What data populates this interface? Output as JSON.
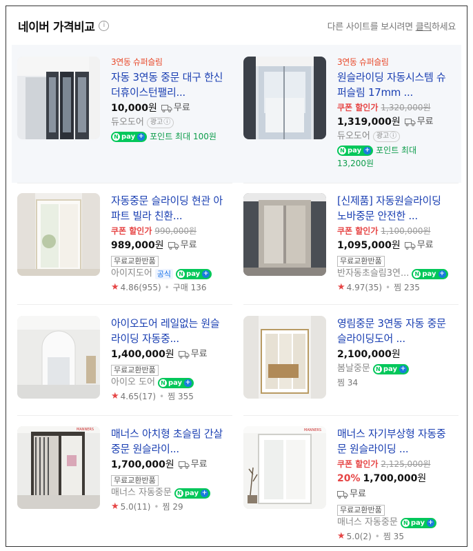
{
  "header": {
    "title": "네이버 가격비교",
    "info_icon": "i",
    "right_prefix": "다른 사이트를 보시려면 ",
    "right_link": "클릭",
    "right_suffix": "하세요"
  },
  "colors": {
    "link": "#1a3fb2",
    "coupon": "#e64545",
    "npay": "#03c75a",
    "accent_tag": "#e8492a"
  },
  "products": [
    {
      "tag": "3연동 슈퍼슬림",
      "title": "자동 3연동 중문 대구 한신더휴이스턴팰리...",
      "price": "10,000",
      "unit": "원",
      "shipping": "무료",
      "seller": "듀오도어",
      "ad_label": "광고",
      "npay": "pay",
      "point": "포인트 최대 100원"
    },
    {
      "tag": "3연동 슈퍼슬림",
      "title": "원슬라이딩 자동시스템 슈퍼슬림 17mm ...",
      "coupon": "쿠폰 할인가",
      "original_price": "1,320,000원",
      "price": "1,319,000",
      "unit": "원",
      "shipping": "무료",
      "seller": "듀오도어",
      "ad_label": "광고",
      "npay": "pay",
      "point": "포인트 최대",
      "point2": "13,200원"
    },
    {
      "title": "자동중문 슬라이딩 현관 아파트 빌라 친환...",
      "coupon": "쿠폰 할인가",
      "original_price": "990,000원",
      "price": "989,000",
      "unit": "원",
      "shipping": "무료",
      "badge": "무료교환반품",
      "seller": "아이지도어",
      "official": "공식",
      "npay": "pay",
      "rating": "4.86",
      "rating_count": "(955)",
      "stat": "구매 136"
    },
    {
      "title": "[신제품] 자동원슬라이딩 노바중문 안전한 ...",
      "coupon": "쿠폰 할인가",
      "original_price": "1,100,000원",
      "price": "1,095,000",
      "unit": "원",
      "shipping": "무료",
      "badge": "무료교환반품",
      "seller": "반자동초슬림3연...",
      "npay": "pay",
      "rating": "4.97",
      "rating_count": "(35)",
      "stat": "찜 235"
    },
    {
      "title": "아이오도어 레일없는 원슬라이딩 자동중...",
      "price": "1,400,000",
      "unit": "원",
      "shipping": "무료",
      "badge": "무료교환반품",
      "seller": "아이오 도어",
      "npay": "pay",
      "rating": "4.65",
      "rating_count": "(17)",
      "stat": "찜 355"
    },
    {
      "title": "영림중문 3연동 자동 중문 슬라이딩도어 ...",
      "price": "2,100,000",
      "unit": "원",
      "seller": "봄날중문",
      "npay": "pay",
      "stat": "찜 34"
    },
    {
      "title": "매너스 아치형 초슬림 간살중문 원슬라이...",
      "price": "1,700,000",
      "unit": "원",
      "shipping": "무료",
      "badge": "무료교환반품",
      "seller": "매너스 자동중문",
      "npay": "pay",
      "rating": "5.0",
      "rating_count": "(11)",
      "stat": "찜 29"
    },
    {
      "title": "매너스 자기부상형 자동중문 원슬라이딩 ...",
      "coupon": "쿠폰 할인가",
      "original_price": "2,125,000원",
      "discount": "20%",
      "price": "1,700,000",
      "unit": "원",
      "shipping": "무료",
      "badge": "무료교환반품",
      "seller": "매너스 자동중문",
      "npay": "pay",
      "rating": "5.0",
      "rating_count": "(2)",
      "stat": "찜 35"
    }
  ]
}
